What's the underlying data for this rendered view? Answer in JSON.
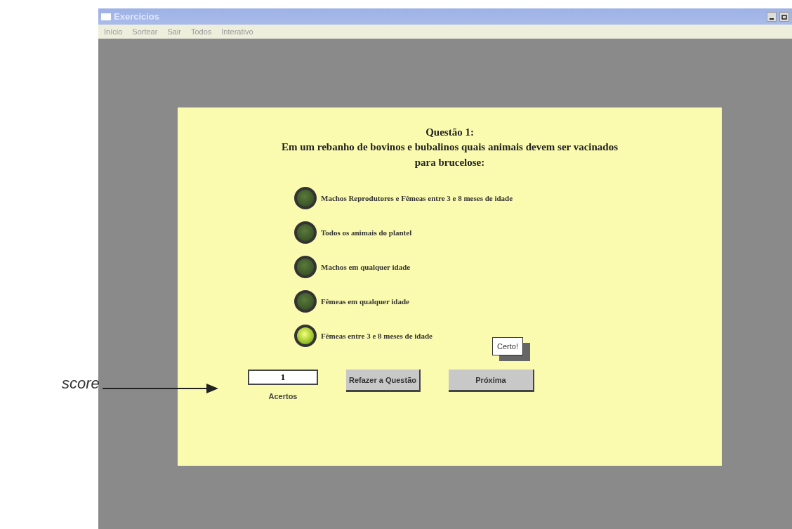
{
  "window": {
    "title": "Exercícios"
  },
  "menu": [
    "Início",
    "Sortear",
    "Sair",
    "Todos",
    "Interativo"
  ],
  "question": {
    "title": "Questão 1:",
    "text": "Em um rebanho de bovinos e bubalinos quais animais devem ser vacinados para brucelose:"
  },
  "options": [
    {
      "label": "Machos Reprodutores e Fêmeas entre 3 e 8 meses de idade",
      "selected": false
    },
    {
      "label": "Todos os animais do plantel",
      "selected": false
    },
    {
      "label": "Machos em qualquer idade",
      "selected": false
    },
    {
      "label": "Fêmeas em qualquer idade",
      "selected": false
    },
    {
      "label": "Fêmeas entre 3 e 8 meses de idade",
      "selected": true
    }
  ],
  "score": {
    "value": "1",
    "label": "Acertos"
  },
  "buttons": [
    "Refazer a Questão",
    "Próxima"
  ],
  "tooltip": "Certo!",
  "annotation": "score"
}
